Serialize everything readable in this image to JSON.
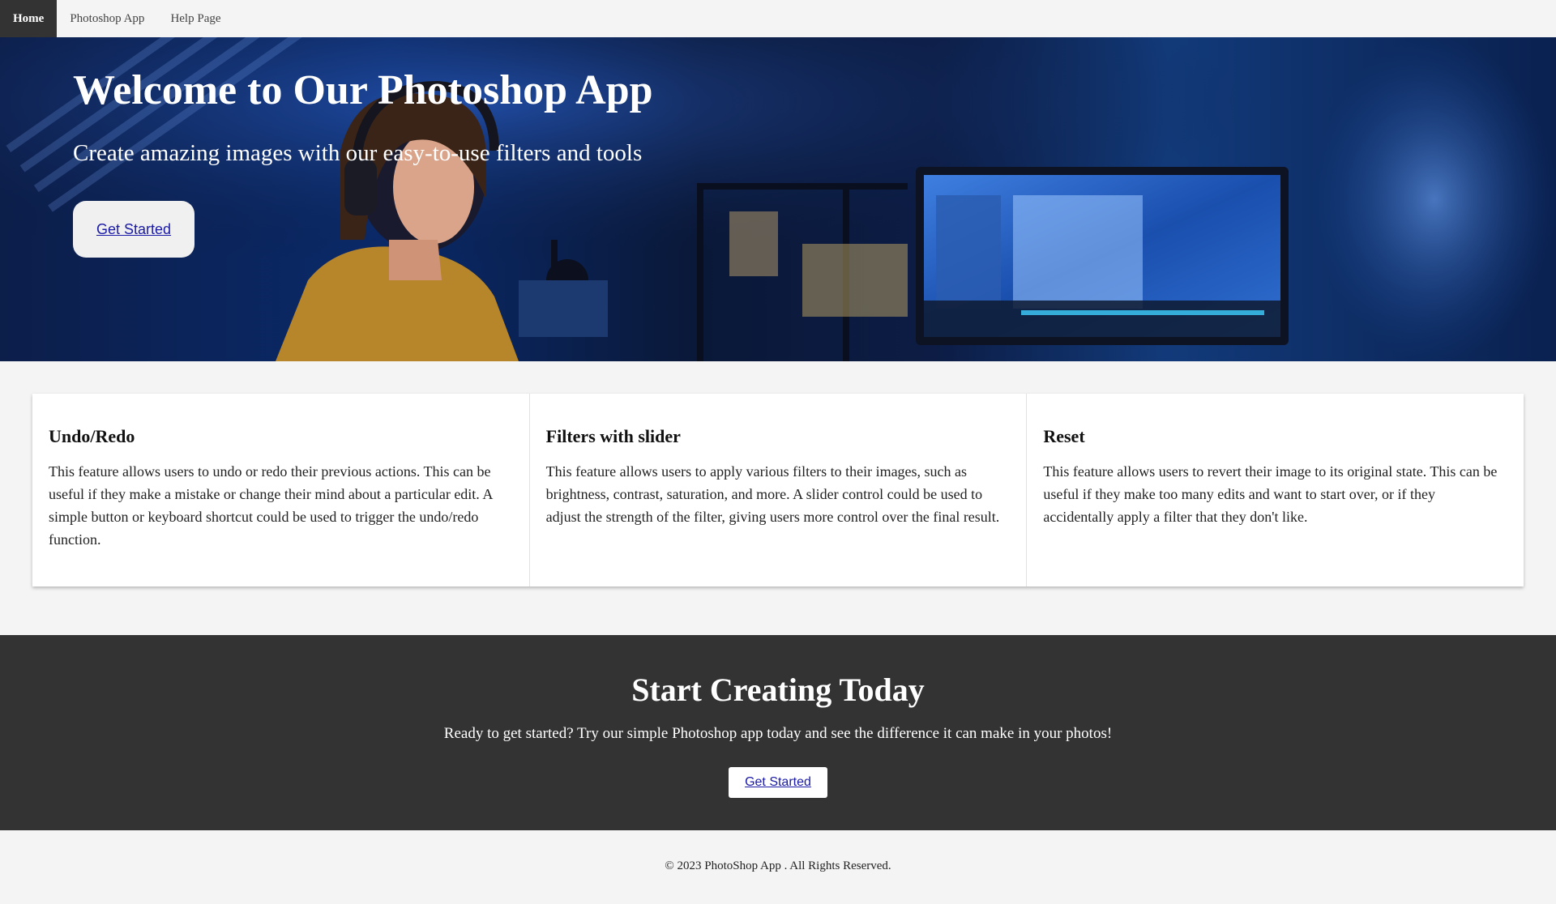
{
  "nav": {
    "items": [
      {
        "label": "Home",
        "active": true
      },
      {
        "label": "Photoshop App",
        "active": false
      },
      {
        "label": "Help Page",
        "active": false
      }
    ]
  },
  "hero": {
    "title": "Welcome to Our Photoshop App",
    "subtitle": "Create amazing images with our easy-to-use filters and tools",
    "button_label": "Get Started"
  },
  "features": [
    {
      "title": "Undo/Redo",
      "description": "This feature allows users to undo or redo their previous actions. This can be useful if they make a mistake or change their mind about a particular edit. A simple button or keyboard shortcut could be used to trigger the undo/redo function."
    },
    {
      "title": "Filters with slider",
      "description": "This feature allows users to apply various filters to their images, such as brightness, contrast, saturation, and more. A slider control could be used to adjust the strength of the filter, giving users more control over the final result."
    },
    {
      "title": "Reset",
      "description": "This feature allows users to revert their image to its original state. This can be useful if they make too many edits and want to start over, or if they accidentally apply a filter that they don't like."
    }
  ],
  "cta": {
    "title": "Start Creating Today",
    "text": "Ready to get started? Try our simple Photoshop app today and see the difference it can make in your photos!",
    "button_label": "Get Started"
  },
  "footer": {
    "text": "© 2023 PhotoShop App . All Rights Reserved."
  },
  "colors": {
    "nav_active_bg": "#333333",
    "cta_bg": "#333333",
    "link": "#1a1aa6",
    "page_bg": "#f4f4f4"
  }
}
